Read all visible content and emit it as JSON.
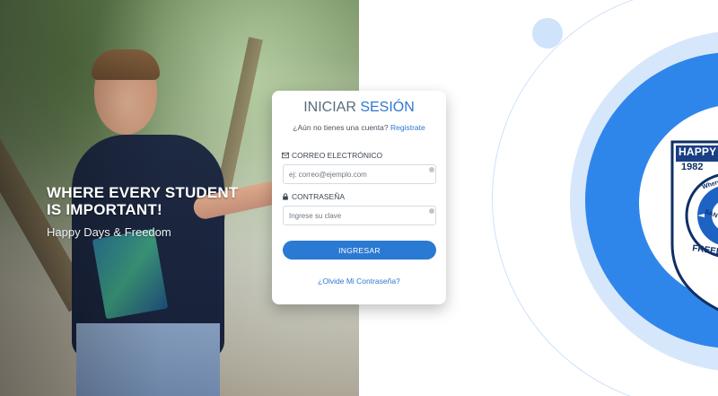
{
  "hero": {
    "title_line1": "WHERE EVERY STUDENT",
    "title_line2": "IS IMPORTANT!",
    "subtitle": "Happy Days & Freedom"
  },
  "login": {
    "title_part1": "INICIAR",
    "title_part2": "SESIÓN",
    "register_prompt": "¿Aún no tienes una cuenta?",
    "register_link": "Registrate",
    "email_label": "CORREO ELECTRÓNICO",
    "email_placeholder": "ej: correo@ejemplo.com",
    "email_icon": "envelope-icon",
    "password_label": "CONTRASEÑA",
    "password_placeholder": "Ingrese su clave",
    "password_icon": "lock-icon",
    "submit_label": "INGRESAR",
    "forgot_link": "¿Olvide Mi Contraseña?"
  },
  "crest": {
    "top_text": "HAPPY DAYS",
    "year": "1982",
    "ring_text_1": "Where Every Studen",
    "ring_text_2": "SAN PEDRO SULA",
    "bottom_text": "FREEDOM HIG"
  },
  "colors": {
    "accent": "#2a79d3",
    "ring_blue": "#2f86ea",
    "ring_pale": "#d7e7fb"
  }
}
